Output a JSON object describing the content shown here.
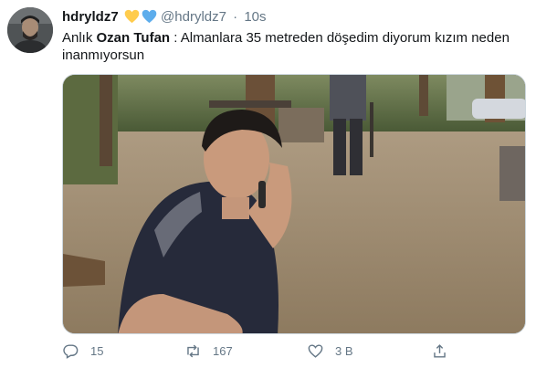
{
  "user": {
    "display_name": "hdryldz7",
    "handle": "@hdryldz7",
    "separator": "·",
    "time": "10s"
  },
  "text": {
    "prefix": "Anlık ",
    "bold": "Ozan Tufan",
    "rest": " : Almanlara 35 metreden döşedim diyorum kızım neden inanmıyorsun"
  },
  "actions": {
    "replies": "15",
    "retweets": "167",
    "likes": "3 B"
  },
  "colors": {
    "heart_yellow": "#ffcc4d",
    "heart_blue": "#5dadec",
    "secondary_text": "#657786"
  }
}
